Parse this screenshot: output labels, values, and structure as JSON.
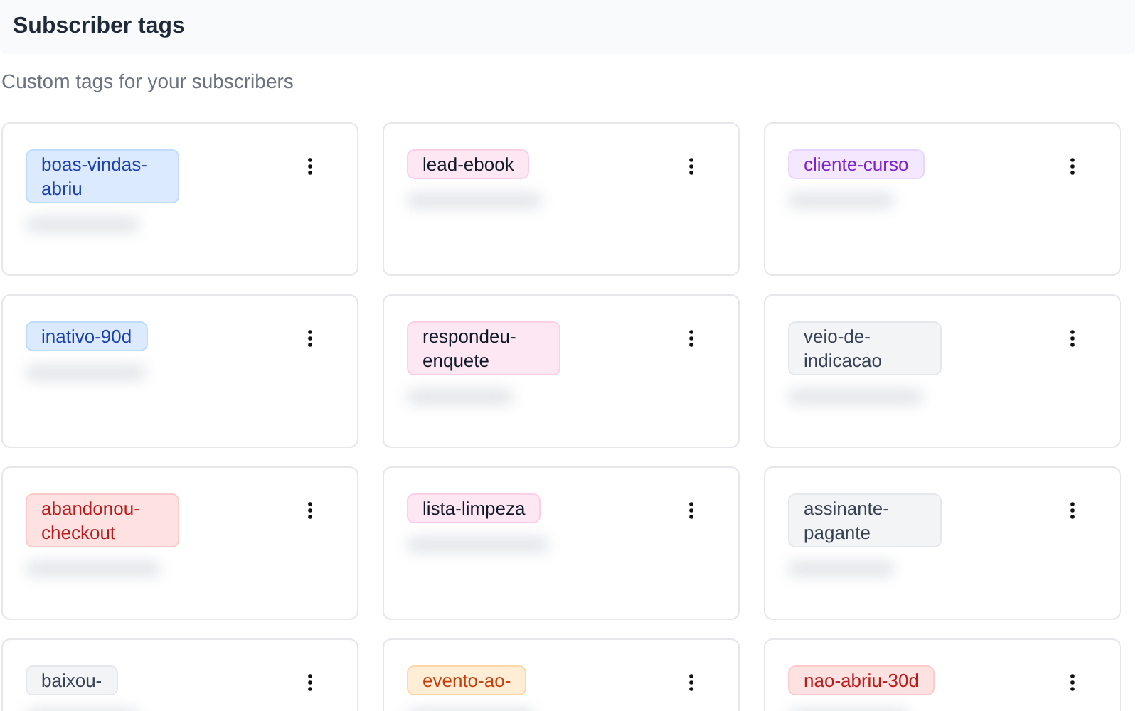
{
  "header": {
    "title": "Subscriber tags"
  },
  "subtitle": "Custom tags for your subscribers",
  "tags": [
    {
      "label": "boas-vindas-abriu",
      "color": "#dbeafe"
    },
    {
      "label": "lead-ebook",
      "color": "#fce7f3"
    },
    {
      "label": "cliente-curso",
      "color": "#f3e8ff"
    },
    {
      "label": "inativo-90d",
      "color": "#dbeafe"
    },
    {
      "label": "respondeu-enquete",
      "color": "#fce7f3"
    },
    {
      "label": "veio-de-indicacao",
      "color": "#f3f4f6"
    },
    {
      "label": "abandonou-checkout",
      "color": "#fee2e2"
    },
    {
      "label": "lista-limpeza",
      "color": "#fce7f3"
    },
    {
      "label": "assinante-pagante",
      "color": "#f3f4f6"
    },
    {
      "label": "baixou-",
      "color": "#f3f4f6"
    },
    {
      "label": "evento-ao-",
      "color": "#ffedd5"
    },
    {
      "label": "nao-abriu-30d",
      "color": "#fee2e2"
    }
  ]
}
